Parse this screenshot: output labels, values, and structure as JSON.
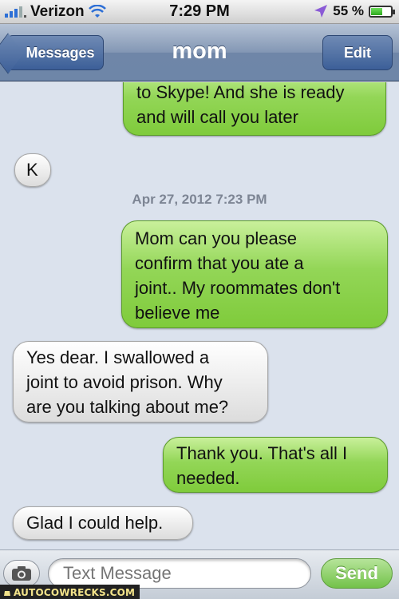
{
  "status_bar": {
    "carrier": "Verizon",
    "time": "7:29 PM",
    "battery": "55 %"
  },
  "nav": {
    "back_label": "Messages",
    "title": "mom",
    "edit_label": "Edit"
  },
  "messages": [
    {
      "type": "sent",
      "text_lines": [
        "to Skype! And she is ready",
        "and will call you later"
      ]
    },
    {
      "type": "received",
      "text_lines": [
        "K"
      ]
    },
    {
      "type": "timestamp",
      "text": "Apr 27, 2012 7:23 PM"
    },
    {
      "type": "sent",
      "text_lines": [
        "Mom can you please",
        "confirm that you ate a",
        "joint.. My roommates don't",
        "believe me"
      ]
    },
    {
      "type": "received",
      "text_lines": [
        "Yes dear. I swallowed a",
        "joint to avoid prison. Why",
        "are you talking about me?"
      ]
    },
    {
      "type": "sent",
      "text_lines": [
        "Thank you. That's all I",
        "needed."
      ]
    },
    {
      "type": "received",
      "text_lines": [
        "Glad I could help."
      ]
    }
  ],
  "input": {
    "placeholder": "Text Message",
    "send_label": "Send"
  },
  "watermark": {
    "text": "AUTOCOWRECKS.COM"
  },
  "colors": {
    "sent_bubble": "#8fd352",
    "received_bubble": "#e8e8e8",
    "background": "#dbe2ed",
    "nav_bar": "#7f93b2"
  }
}
